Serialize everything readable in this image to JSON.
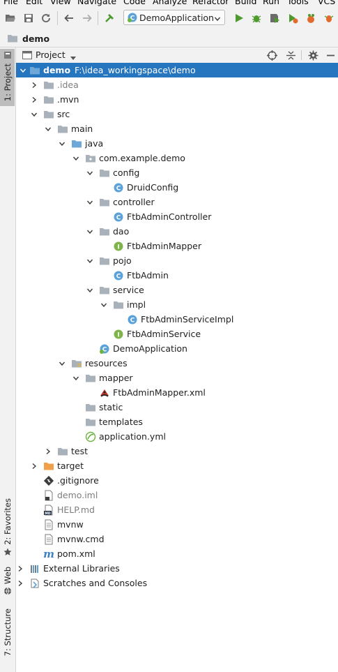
{
  "menu": [
    "File",
    "Edit",
    "View",
    "Navigate",
    "Code",
    "Analyze",
    "Refactor",
    "Build",
    "Run",
    "Tools",
    "VCS"
  ],
  "toolbar": {
    "run_config": "DemoApplication"
  },
  "breadcrumb": {
    "project": "demo"
  },
  "tool_strip": {
    "project": "1: Project",
    "favorites": "2: Favorites",
    "web": "Web",
    "structure": "7: Structure"
  },
  "panel": {
    "title": "Project"
  },
  "tree": {
    "root": {
      "name": "demo",
      "path": "F:\\idea_workingspace\\demo"
    },
    "items": {
      "idea": ".idea",
      "mvn": ".mvn",
      "src": "src",
      "main": "main",
      "java": "java",
      "pkg": "com.example.demo",
      "config": "config",
      "druid": "DruidConfig",
      "controller": "controller",
      "admin_controller": "FtbAdminController",
      "dao": "dao",
      "admin_mapper": "FtbAdminMapper",
      "pojo": "pojo",
      "admin": "FtbAdmin",
      "service": "service",
      "impl": "impl",
      "admin_service_impl": "FtbAdminServiceImpl",
      "admin_service": "FtbAdminService",
      "demo_app": "DemoApplication",
      "resources": "resources",
      "mapper": "mapper",
      "mapper_xml": "FtbAdminMapper.xml",
      "static": "static",
      "templates": "templates",
      "app_yml": "application.yml",
      "test": "test",
      "target": "target",
      "gitignore": ".gitignore",
      "demo_iml": "demo.iml",
      "help_md": "HELP.md",
      "mvnw": "mvnw",
      "mvnw_cmd": "mvnw.cmd",
      "pom": "pom.xml",
      "ext_libs": "External Libraries",
      "scratches": "Scratches and Consoles"
    }
  }
}
